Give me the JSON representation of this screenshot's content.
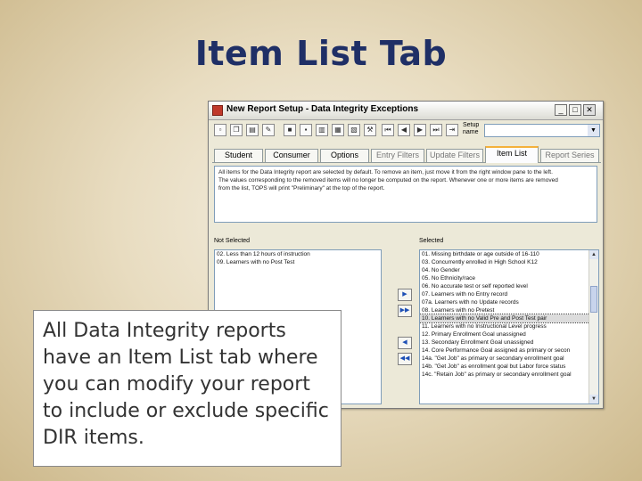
{
  "slide": {
    "title": "Item List Tab",
    "callout": "All Data Integrity reports have an Item List tab where you can modify your report to include or exclude specific DIR items."
  },
  "window": {
    "title": "New Report Setup - Data Integrity Exceptions",
    "setup_name_label": "Setup name",
    "tabs": [
      {
        "label": "Student"
      },
      {
        "label": "Consumer"
      },
      {
        "label": "Options"
      },
      {
        "label": "Entry Filters"
      },
      {
        "label": "Update Filters"
      },
      {
        "label": "Item List"
      },
      {
        "label": "Report Series"
      }
    ],
    "info_text": [
      "All items for the Data Integrity report are selected by default. To remove an item, just move it from the right window pane to the left.",
      "The values corresponding to the removed items will no longer be computed on the report. Whenever one or more items are removed",
      "from the list, TOPS will print \"Preliminary\" at the top of the report."
    ],
    "not_selected_label": "Not Selected",
    "selected_label": "Selected",
    "not_selected_items": [
      "02. Less than 12 hours of instruction",
      "09. Learners with no Post Test"
    ],
    "selected_items": [
      "01. Missing birthdate or age outside of 16-110",
      "03. Concurrently enrolled in High School K12",
      "04. No Gender",
      "05. No Ethnicity/race",
      "06. No accurate test or self reported level",
      "07. Learners with no Entry record",
      "07a. Learners with no Update records",
      "08. Learners with no Pretest",
      "10. Learners with no Valid Pre and Post Test pair",
      "11. Learners with no Instructional Level progress",
      "12. Primary Enrollment Goal unassigned",
      "13. Secondary Enrollment Goal unassigned",
      "14. Core Performance Goal assigned as primary or secon",
      "14a. \"Get Job\" as primary or secondary enrollment goal",
      "14b. \"Get Job\" as enrollment goal but Labor force status",
      "14c. \"Retain Job\" as primary or secondary enrollment goal"
    ],
    "selected_highlight_index": 8
  },
  "colors": {
    "title": "#1f2f66",
    "tab_accent": "#f4b13b",
    "field_border": "#7f9db9"
  }
}
